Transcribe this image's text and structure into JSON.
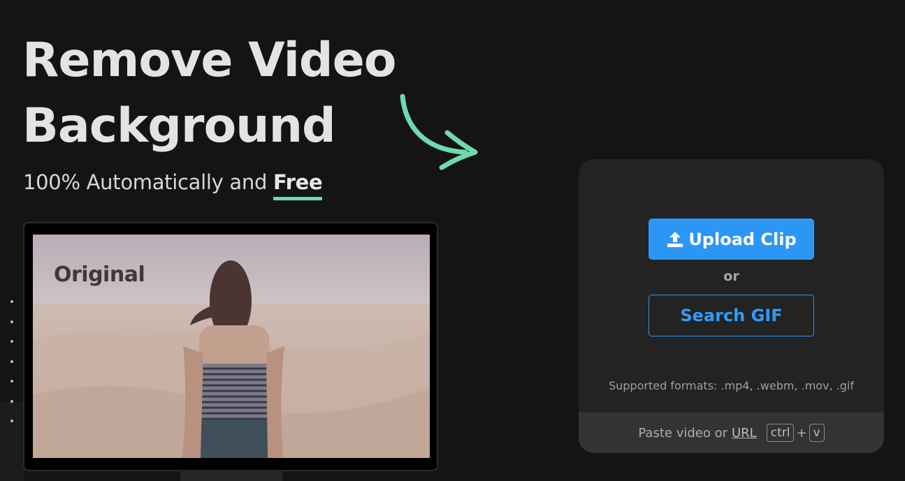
{
  "hero": {
    "title_line1": "Remove Video",
    "title_line2": "Background",
    "subtitle_prefix": "100% Automatically and ",
    "subtitle_highlight": "Free",
    "highlight_color": "#6fd9b0"
  },
  "preview": {
    "overlay_label": "Original"
  },
  "upload": {
    "upload_button_label": "Upload Clip",
    "upload_icon": "upload-icon",
    "or_label": "or",
    "search_gif_label": "Search GIF",
    "supported_formats": "Supported formats: .mp4, .webm, .mov, .gif",
    "paste_prefix": "Paste video or",
    "paste_url": "URL",
    "key_ctrl": "ctrl",
    "key_plus": "+",
    "key_v": "v",
    "accent_color": "#2c96f4"
  }
}
